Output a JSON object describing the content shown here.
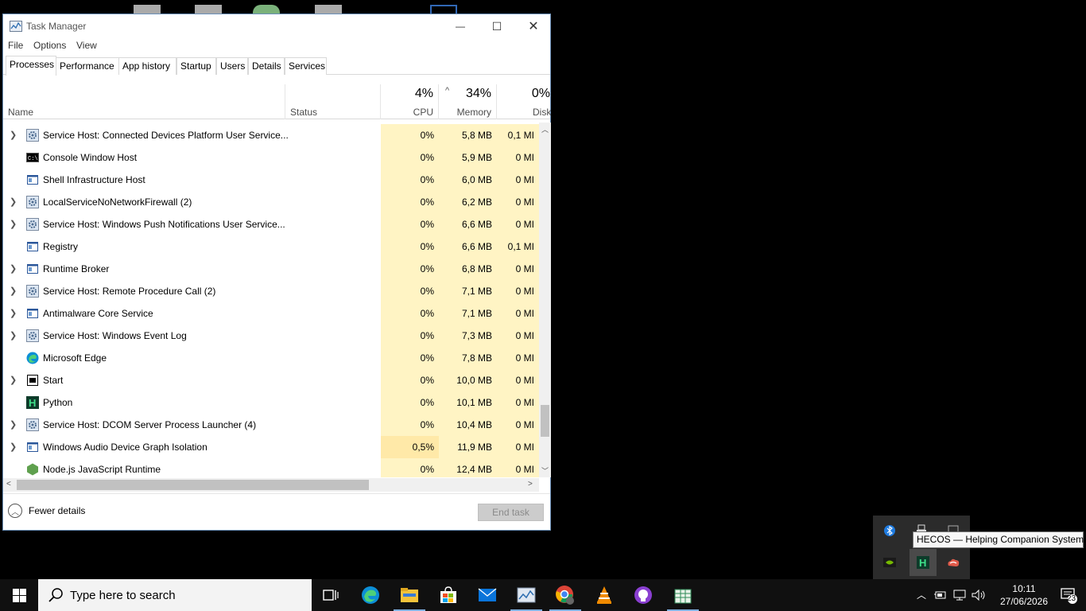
{
  "window": {
    "title": "Task Manager",
    "controls": {
      "minimize": "—",
      "maximize": "☐",
      "close": "✕"
    }
  },
  "menu": [
    "File",
    "Options",
    "View"
  ],
  "tabs": [
    "Processes",
    "Performance",
    "App history",
    "Startup",
    "Users",
    "Details",
    "Services"
  ],
  "active_tab": "Processes",
  "columns": {
    "name": "Name",
    "status": "Status",
    "cpu": {
      "pct": "4%",
      "label": "CPU"
    },
    "memory": {
      "pct": "34%",
      "label": "Memory",
      "sort_indicator": "^"
    },
    "disk": {
      "pct": "0%",
      "label": "Disk"
    }
  },
  "processes": [
    {
      "name": "Service Host: Connected Devices Platform User Service...",
      "cpu": "0%",
      "mem": "5,8 MB",
      "disk": "0,1 MI",
      "expand": true,
      "icon": "gear-icon"
    },
    {
      "name": "Console Window Host",
      "cpu": "0%",
      "mem": "5,9 MB",
      "disk": "0 MI",
      "expand": false,
      "icon": "console-icon"
    },
    {
      "name": "Shell Infrastructure Host",
      "cpu": "0%",
      "mem": "6,0 MB",
      "disk": "0 MI",
      "expand": false,
      "icon": "window-icon"
    },
    {
      "name": "LocalServiceNoNetworkFirewall (2)",
      "cpu": "0%",
      "mem": "6,2 MB",
      "disk": "0 MI",
      "expand": true,
      "icon": "gear-icon"
    },
    {
      "name": "Service Host: Windows Push Notifications User Service...",
      "cpu": "0%",
      "mem": "6,6 MB",
      "disk": "0 MI",
      "expand": true,
      "icon": "gear-icon"
    },
    {
      "name": "Registry",
      "cpu": "0%",
      "mem": "6,6 MB",
      "disk": "0,1 MI",
      "expand": false,
      "icon": "window-icon"
    },
    {
      "name": "Runtime Broker",
      "cpu": "0%",
      "mem": "6,8 MB",
      "disk": "0 MI",
      "expand": true,
      "icon": "window-icon"
    },
    {
      "name": "Service Host: Remote Procedure Call (2)",
      "cpu": "0%",
      "mem": "7,1 MB",
      "disk": "0 MI",
      "expand": true,
      "icon": "gear-icon"
    },
    {
      "name": "Antimalware Core Service",
      "cpu": "0%",
      "mem": "7,1 MB",
      "disk": "0 MI",
      "expand": true,
      "icon": "window-icon"
    },
    {
      "name": "Service Host: Windows Event Log",
      "cpu": "0%",
      "mem": "7,3 MB",
      "disk": "0 MI",
      "expand": true,
      "icon": "gear-icon"
    },
    {
      "name": "Microsoft Edge",
      "cpu": "0%",
      "mem": "7,8 MB",
      "disk": "0 MI",
      "expand": false,
      "icon": "edge-icon"
    },
    {
      "name": "Start",
      "cpu": "0%",
      "mem": "10,0 MB",
      "disk": "0 MI",
      "expand": true,
      "icon": "start-window-icon"
    },
    {
      "name": "Python",
      "cpu": "0%",
      "mem": "10,1 MB",
      "disk": "0 MI",
      "expand": false,
      "icon": "hecos-icon"
    },
    {
      "name": "Service Host: DCOM Server Process Launcher (4)",
      "cpu": "0%",
      "mem": "10,4 MB",
      "disk": "0 MI",
      "expand": true,
      "icon": "gear-icon"
    },
    {
      "name": "Windows Audio Device Graph Isolation",
      "cpu": "0,5%",
      "mem": "11,9 MB",
      "disk": "0 MI",
      "expand": true,
      "icon": "window-icon"
    },
    {
      "name": "Node.js JavaScript Runtime",
      "cpu": "0%",
      "mem": "12,4 MB",
      "disk": "0 MI",
      "expand": false,
      "icon": "nodejs-icon"
    }
  ],
  "footer": {
    "fewer_details": "Fewer details",
    "end_task": "End task"
  },
  "tooltip": "HECOS — Helping Companion System",
  "taskbar": {
    "search_placeholder": "Type here to search",
    "time": "10:11",
    "date": "27/06/2026",
    "notification_count": "23"
  },
  "colors": {
    "cpu_highlight": "#fff4c4",
    "cpu_highlight_active": "#ffe9a8",
    "taskbar": "#101010"
  }
}
